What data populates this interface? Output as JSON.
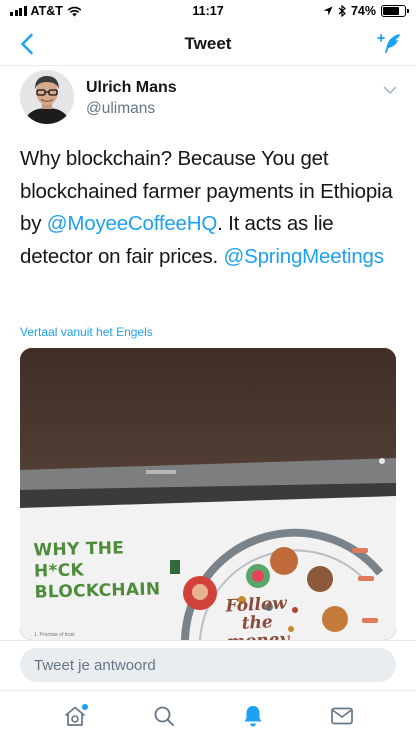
{
  "status_bar": {
    "carrier": "AT&T",
    "time": "11:17",
    "battery": "74%",
    "battery_level": 0.74
  },
  "nav": {
    "title": "Tweet"
  },
  "tweet": {
    "author_name": "Ulrich Mans",
    "author_handle": "@ulimans",
    "text_before": "Why blockchain? Because You get blockchained farmer payments in Ethiopia by ",
    "mention_1": "@MoyeeCoffeeHQ",
    "text_after": ". It acts as lie detector on fair prices. ",
    "mention_2": "@SpringMeetings",
    "translate_link": "Vertaal vanuit het Engels"
  },
  "media": {
    "slide_title_lines": [
      "WHY THE",
      "H*CK",
      "BLOCKCHAIN"
    ],
    "slide_follow_lines": [
      "Follow",
      "the",
      "money"
    ],
    "slide_caption": "1. Promise of trust"
  },
  "reply": {
    "placeholder": "Tweet je antwoord"
  },
  "tabs": [
    {
      "icon": "home-icon",
      "active": false,
      "has_dot": true
    },
    {
      "icon": "search-icon",
      "active": false,
      "has_dot": false
    },
    {
      "icon": "bell-icon",
      "active": true,
      "has_dot": false
    },
    {
      "icon": "mail-icon",
      "active": false,
      "has_dot": false
    }
  ],
  "colors": {
    "accent": "#1da1f2",
    "text_primary": "#14171a",
    "text_secondary": "#657786",
    "slide_green": "#4e8b3a"
  }
}
